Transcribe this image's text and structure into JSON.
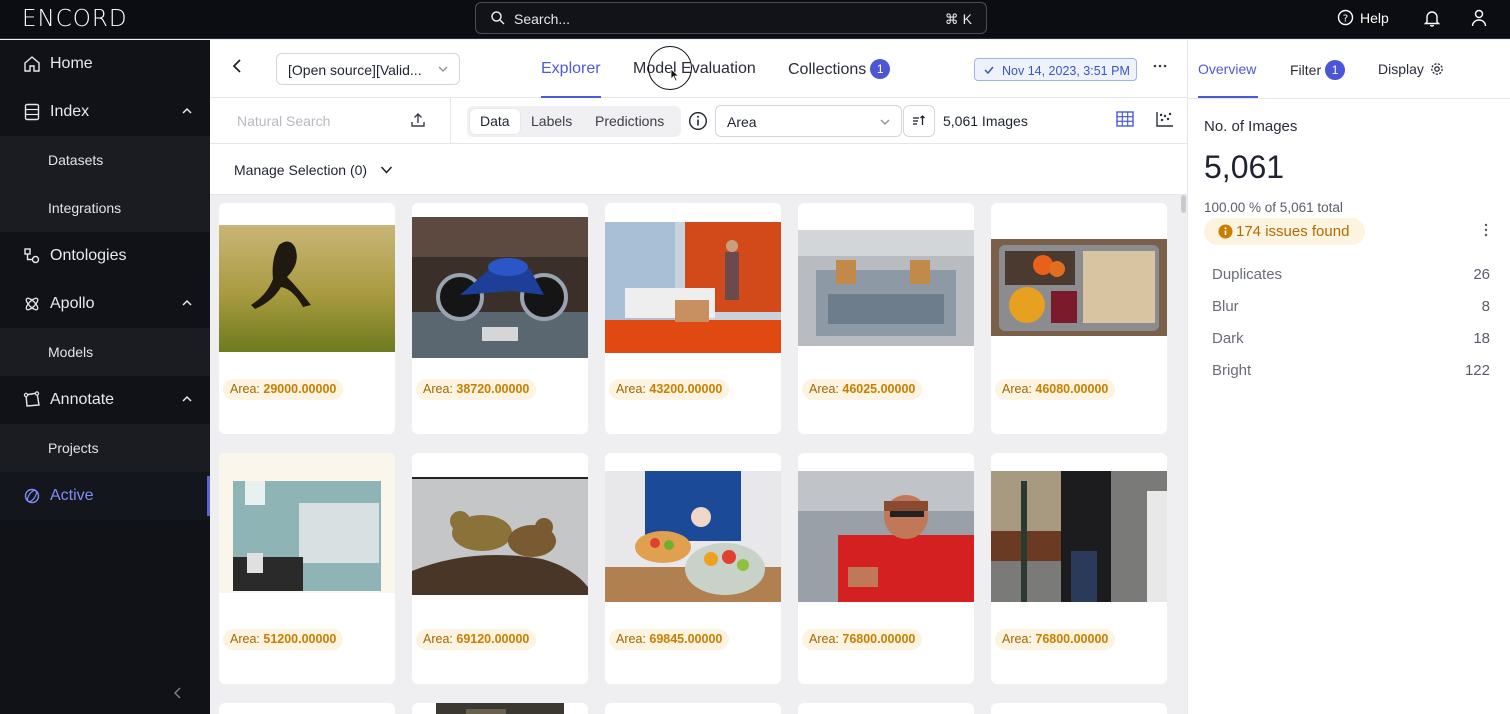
{
  "app": {
    "logo": "ENCORD"
  },
  "topbar": {
    "search_label": "Search...",
    "search_shortcut": "⌘ K",
    "help_label": "Help"
  },
  "sidebar": {
    "items": [
      {
        "label": "Home",
        "icon": "home-icon"
      },
      {
        "label": "Index",
        "icon": "index-icon",
        "expanded": true
      },
      {
        "label": "Datasets"
      },
      {
        "label": "Integrations"
      },
      {
        "label": "Ontologies",
        "icon": "ontology-icon"
      },
      {
        "label": "Apollo",
        "icon": "apollo-icon",
        "expanded": true
      },
      {
        "label": "Models"
      },
      {
        "label": "Annotate",
        "icon": "annotate-icon",
        "expanded": true
      },
      {
        "label": "Projects"
      },
      {
        "label": "Active",
        "icon": "active-icon",
        "active": true
      }
    ]
  },
  "header": {
    "dataset_label": "[Open source][Valid...",
    "tabs": [
      {
        "label": "Explorer",
        "active": true
      },
      {
        "label": "Model Evaluation"
      },
      {
        "label": "Collections",
        "badge": "1"
      }
    ],
    "date_label": "Nov 14, 2023, 3:51 PM"
  },
  "toolbar": {
    "natural_search_placeholder": "Natural Search",
    "segments": [
      "Data",
      "Labels",
      "Predictions"
    ],
    "sort_field": "Area",
    "count_label": "5,061 Images"
  },
  "selection": {
    "label": "Manage Selection (0)"
  },
  "gallery": {
    "prefix": "Area:",
    "cards": [
      {
        "value": "29000.00000"
      },
      {
        "value": "38720.00000"
      },
      {
        "value": "43200.00000"
      },
      {
        "value": "46025.00000"
      },
      {
        "value": "46080.00000"
      },
      {
        "value": "51200.00000"
      },
      {
        "value": "69120.00000"
      },
      {
        "value": "69845.00000"
      },
      {
        "value": "76800.00000"
      },
      {
        "value": "76800.00000"
      }
    ]
  },
  "right_panel": {
    "tabs": [
      {
        "label": "Overview",
        "active": true
      },
      {
        "label": "Filter",
        "badge": "1"
      },
      {
        "label": "Display"
      }
    ],
    "title": "No. of Images",
    "count": "5,061",
    "percent_label": "100.00 % of 5,061 total",
    "issues_label": "174 issues found",
    "issues": [
      {
        "label": "Duplicates",
        "value": "26"
      },
      {
        "label": "Blur",
        "value": "8"
      },
      {
        "label": "Dark",
        "value": "18"
      },
      {
        "label": "Bright",
        "value": "122"
      }
    ]
  },
  "colors": {
    "accent": "#4c5ad8",
    "sidebar_bg": "#101217",
    "warning": "#c87f00"
  }
}
